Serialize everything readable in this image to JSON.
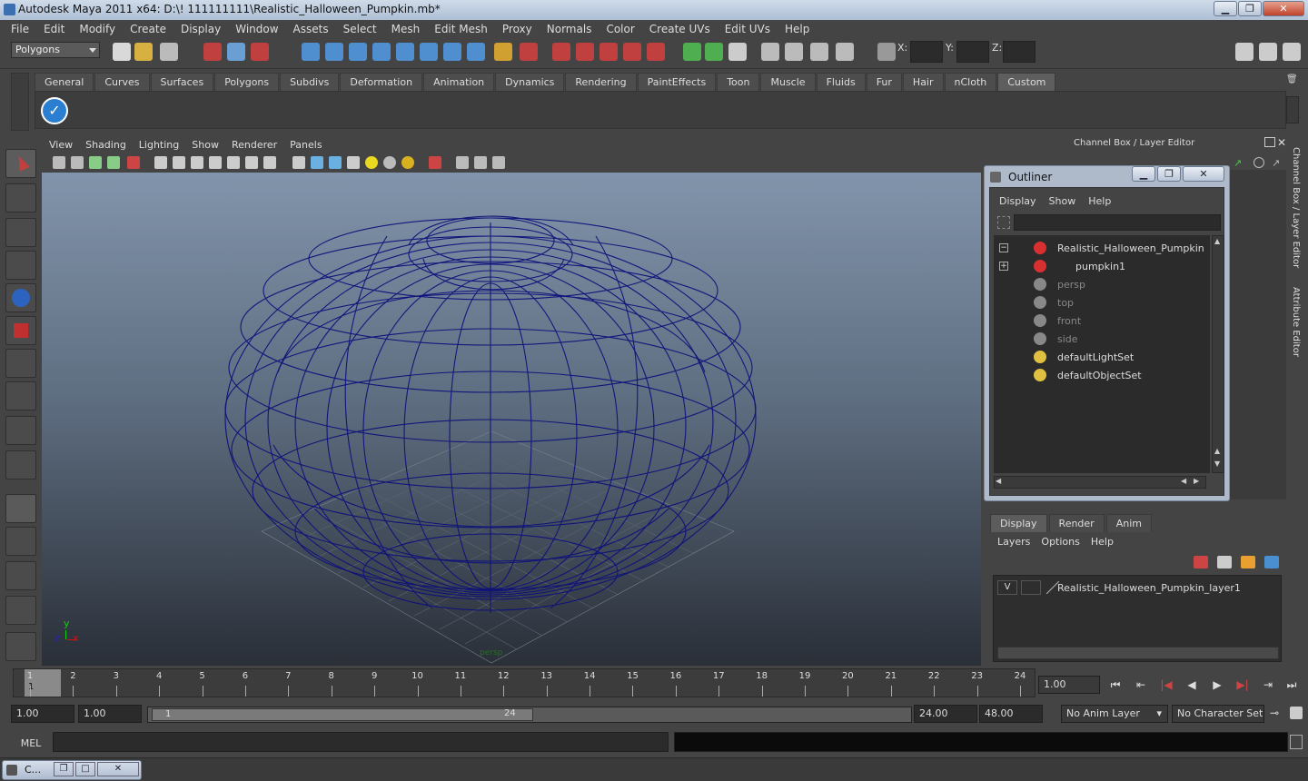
{
  "window": {
    "title": "Autodesk Maya 2011 x64: D:\\! 111111111\\Realistic_Halloween_Pumpkin.mb*"
  },
  "menu": [
    "File",
    "Edit",
    "Modify",
    "Create",
    "Display",
    "Window",
    "Assets",
    "Select",
    "Mesh",
    "Edit Mesh",
    "Proxy",
    "Normals",
    "Color",
    "Create UVs",
    "Edit UVs",
    "Help"
  ],
  "status": {
    "mode": "Polygons",
    "x_label": "X:",
    "y_label": "Y:",
    "z_label": "Z:"
  },
  "shelf": {
    "tabs": [
      "General",
      "Curves",
      "Surfaces",
      "Polygons",
      "Subdivs",
      "Deformation",
      "Animation",
      "Dynamics",
      "Rendering",
      "PaintEffects",
      "Toon",
      "Muscle",
      "Fluids",
      "Fur",
      "Hair",
      "nCloth",
      "Custom"
    ],
    "active": "Custom"
  },
  "panel": {
    "menu": [
      "View",
      "Shading",
      "Lighting",
      "Show",
      "Renderer",
      "Panels"
    ],
    "camera_label": "persp"
  },
  "channel_box": {
    "title": "Channel Box / Layer Editor"
  },
  "side_tabs": [
    "Channel Box / Layer Editor",
    "Attribute Editor"
  ],
  "outliner": {
    "title": "Outliner",
    "menu": [
      "Display",
      "Show",
      "Help"
    ],
    "items": [
      {
        "label": "Realistic_Halloween_Pumpkin",
        "dim": false
      },
      {
        "label": "pumpkin1",
        "dim": false
      },
      {
        "label": "persp",
        "dim": true
      },
      {
        "label": "top",
        "dim": true
      },
      {
        "label": "front",
        "dim": true
      },
      {
        "label": "side",
        "dim": true
      },
      {
        "label": "defaultLightSet",
        "dim": false
      },
      {
        "label": "defaultObjectSet",
        "dim": false
      }
    ]
  },
  "layer_editor": {
    "tabs": [
      "Display",
      "Render",
      "Anim"
    ],
    "menu": [
      "Layers",
      "Options",
      "Help"
    ],
    "visible_flag": "V",
    "layer": "Realistic_Halloween_Pumpkin_layer1"
  },
  "timeline": {
    "ticks": [
      "1",
      "2",
      "3",
      "4",
      "5",
      "6",
      "7",
      "8",
      "9",
      "10",
      "11",
      "12",
      "13",
      "14",
      "15",
      "16",
      "17",
      "18",
      "19",
      "20",
      "21",
      "22",
      "23",
      "24"
    ],
    "current_marker": "1",
    "current_time": "1.00"
  },
  "range": {
    "start_time": "1.00",
    "playback_start": "1.00",
    "range_start_label": "1",
    "range_end_label": "24",
    "playback_end": "24.00",
    "end_time": "48.00",
    "anim_layer": "No Anim Layer",
    "character_set": "No Character Set"
  },
  "cmd": {
    "label": "MEL"
  },
  "taskbar": {
    "item": "C..."
  },
  "colors": {
    "wire": "#0e117a",
    "accent": "#3a70b0"
  }
}
